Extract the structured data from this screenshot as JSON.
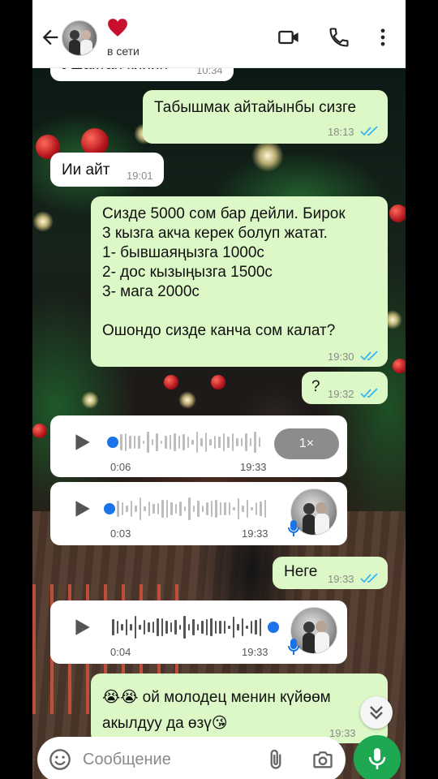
{
  "header": {
    "contact_emoji": "❤",
    "status": "в сети",
    "icons": [
      "back-arrow-icon",
      "video-call-icon",
      "phone-icon",
      "more-vert-icon"
    ]
  },
  "messages": [
    {
      "type": "text",
      "direction": "in",
      "text": "Ушактан кийин",
      "time": "10:34"
    },
    {
      "type": "text",
      "direction": "out",
      "text": "Табышмак айтайынбы сизге",
      "time": "18:13",
      "read": true
    },
    {
      "type": "text",
      "direction": "in",
      "text": "Ии айт",
      "time": "19:01"
    },
    {
      "type": "text",
      "direction": "out",
      "text": "Сизде 5000 сом бар дейли. Бирок\n3 кызга акча керек болуп жатат.\n1- бывшаяңызга 1000с\n2- дос кызыңызга 1500с\n3- мага 2000с\n\nОшондо сизде канча сом калат?",
      "time": "19:30",
      "read": true
    },
    {
      "type": "text",
      "direction": "out",
      "text": "?",
      "time": "19:32",
      "read": true
    },
    {
      "type": "voice",
      "direction": "in",
      "duration": "0:06",
      "time": "19:33",
      "speed": "1×",
      "progress": 0
    },
    {
      "type": "voice",
      "direction": "in",
      "duration": "0:03",
      "time": "19:33",
      "progress": 0
    },
    {
      "type": "text",
      "direction": "out",
      "text": "Неге",
      "time": "19:33",
      "read": true
    },
    {
      "type": "voice",
      "direction": "in",
      "duration": "0:04",
      "time": "19:33",
      "progress": 1
    },
    {
      "type": "text",
      "direction": "out",
      "text": "😭😭 ой молодец менин күйөөм\nакылдуу да өзү😘",
      "time": "19:33"
    }
  ],
  "composer": {
    "placeholder": "Сообщение",
    "icons": [
      "emoji-icon",
      "attach-icon",
      "camera-icon",
      "mic-icon"
    ]
  },
  "colors": {
    "incoming_bubble": "#ffffff",
    "outgoing_bubble": "#dcf8c6",
    "read_ticks": "#34b7f1",
    "voice_dot": "#1a73e8",
    "fab": "#1da851"
  }
}
